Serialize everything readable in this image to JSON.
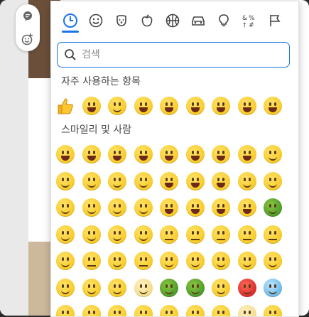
{
  "tabs": [
    {
      "name": "recent",
      "icon": "clock-icon",
      "selected": true
    },
    {
      "name": "smileys",
      "icon": "smiley-icon"
    },
    {
      "name": "animals",
      "icon": "dog-icon"
    },
    {
      "name": "food",
      "icon": "apple-icon"
    },
    {
      "name": "activities",
      "icon": "basketball-icon"
    },
    {
      "name": "travel",
      "icon": "car-icon"
    },
    {
      "name": "objects",
      "icon": "lightbulb-icon"
    },
    {
      "name": "symbols",
      "icon": "symbols-icon"
    },
    {
      "name": "flags",
      "icon": "flag-icon"
    }
  ],
  "search": {
    "placeholder": "검색",
    "value": ""
  },
  "sections": {
    "frequent": "자주 사용하는 항목",
    "smileys": "스마일리 및 사람"
  },
  "frequent_emojis": [
    "👍",
    "😀",
    "😘",
    "😍",
    "😆",
    "😜",
    "😅",
    "😂",
    "😱"
  ],
  "smiley_rows": [
    [
      "😀",
      "😃",
      "😄",
      "😁",
      "😆",
      "😅",
      "🤣",
      "😂",
      "🙂"
    ],
    [
      "🙃",
      "😉",
      "😊",
      "😇",
      "🥰",
      "😍",
      "🤩",
      "😘",
      "😗"
    ],
    [
      "☺️",
      "😚",
      "😙",
      "😋",
      "😛",
      "😜",
      "🤪",
      "😝",
      "🤑"
    ],
    [
      "🤗",
      "🤭",
      "🤫",
      "🤔",
      "🤐",
      "🤨",
      "😐",
      "😑",
      "😶"
    ],
    [
      "😏",
      "😒",
      "🙄",
      "😬",
      "🤥",
      "😌",
      "😔",
      "😪",
      "🤤"
    ],
    [
      "😴",
      "😷",
      "🤒",
      "🤕",
      "🤢",
      "🤮",
      "🤧",
      "🥵",
      "🥶"
    ],
    [
      "🥴",
      "😵",
      "🤯",
      "🤠",
      "🥳",
      "😎",
      "🤓",
      "🧐",
      "😕"
    ]
  ],
  "accent_color": "#1a73e8"
}
